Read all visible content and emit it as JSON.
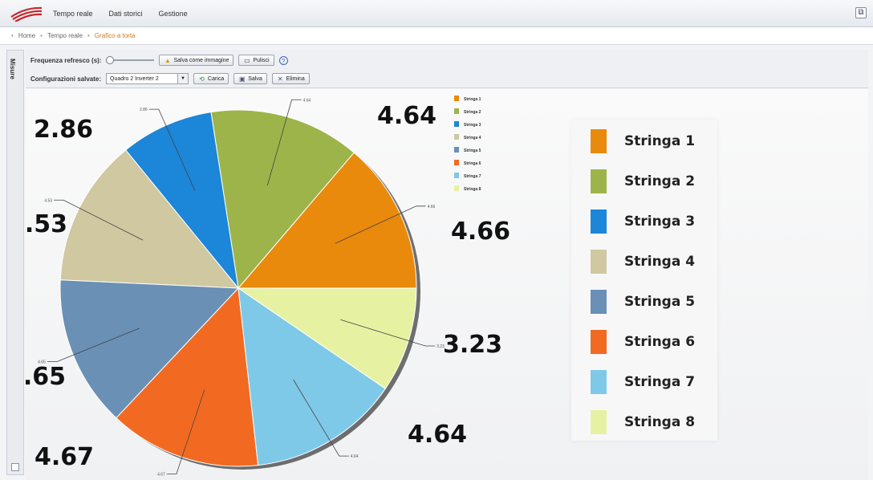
{
  "nav": {
    "items": [
      "Tempo reale",
      "Dati storici",
      "Gestione"
    ]
  },
  "breadcrumb": [
    "Home",
    "Tempo reale",
    "Grafico a torta"
  ],
  "sidetab": {
    "label": "Misure"
  },
  "toolbar": {
    "refresh_label": "Frequenza refresco (s):",
    "save_image_label": "Salva come immagine",
    "clear_label": "Pulisci",
    "configs_label": "Configurazioni salvate:",
    "config_selected": "Quadro 2 Inverter 2",
    "load_label": "Carica",
    "save_label": "Salva",
    "delete_label": "Elimina"
  },
  "chart_data": {
    "type": "pie",
    "categories": [
      "Stringa 1",
      "Stringa 2",
      "Stringa 3",
      "Stringa 4",
      "Stringa 5",
      "Stringa 6",
      "Stringa 7",
      "Stringa 8"
    ],
    "values": [
      4.66,
      4.64,
      2.86,
      4.53,
      4.65,
      4.67,
      4.64,
      3.23
    ],
    "value_labels": [
      "4.66",
      "4.64",
      "2.86",
      "4.53",
      "4.65",
      "4.67",
      "4.64",
      "3.23"
    ],
    "colors": [
      "#e98a0c",
      "#9db44a",
      "#1c86d8",
      "#cfc8a0",
      "#6a90b5",
      "#f26a22",
      "#7fc9e8",
      "#e6f2a2"
    ],
    "legend_placement": "right"
  }
}
